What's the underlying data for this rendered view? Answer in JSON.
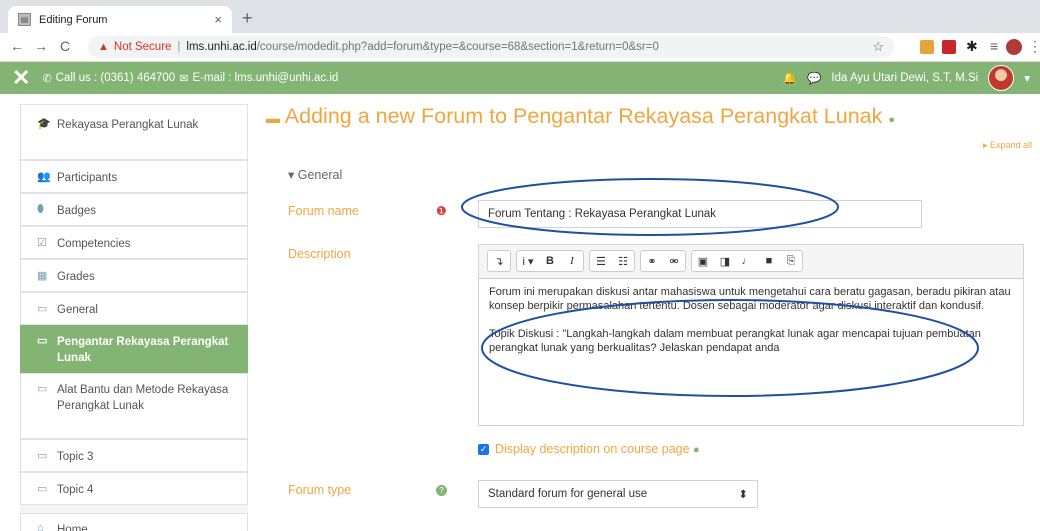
{
  "browser": {
    "tab_title": "Editing Forum",
    "tab_close": "×",
    "new_tab": "+",
    "back": "←",
    "forward": "→",
    "reload": "C",
    "security_label": "Not Secure",
    "url_host": "lms.unhi.ac.id",
    "url_path": "/course/modedit.php?add=forum&type=&course=68&section=1&return=0&sr=0"
  },
  "navbar": {
    "close_symbol": "✕",
    "phone": "Call us : (0361) 464700",
    "email": "E-mail : lms.unhi@unhi.ac.id",
    "user_name": "Ida Ayu Utari Dewi, S.T, M.Si"
  },
  "sidebar": {
    "items": [
      {
        "label": "Rekayasa Perangkat Lunak",
        "icon": "graduation-cap-icon",
        "glyph": "🎓"
      },
      {
        "label": "Participants",
        "icon": "users-icon",
        "glyph": "👥"
      },
      {
        "label": "Badges",
        "icon": "badge-icon",
        "glyph": "⬮"
      },
      {
        "label": "Competencies",
        "icon": "checkbox-icon",
        "glyph": "☑"
      },
      {
        "label": "Grades",
        "icon": "table-icon",
        "glyph": "▦"
      },
      {
        "label": "General",
        "icon": "folder-icon",
        "glyph": "▭"
      },
      {
        "label": "Pengantar Rekayasa Perangkat Lunak",
        "icon": "folder-icon",
        "glyph": "▭"
      },
      {
        "label": "Alat Bantu dan Metode Rekayasa Perangkat Lunak",
        "icon": "folder-icon",
        "glyph": "▭"
      },
      {
        "label": "Topic 3",
        "icon": "folder-icon",
        "glyph": "▭"
      },
      {
        "label": "Topic 4",
        "icon": "folder-icon",
        "glyph": "▭"
      },
      {
        "label": "Home",
        "icon": "home-icon",
        "glyph": "⌂"
      }
    ]
  },
  "main": {
    "title": "Adding a new Forum to Pengantar Rekayasa Perangkat Lunak",
    "expand_all": "Expand all",
    "legend": "General",
    "forum_name_label": "Forum name",
    "forum_name_value": "Forum Tentang : Rekayasa Perangkat Lunak",
    "description_label": "Description",
    "description_p1": "Forum ini merupakan diskusi antar mahasiswa untuk mengetahui cara beratu gagasan, beradu pikiran atau konsep berpikir permasalahan tertentu. Dosen sebagai moderator agar diskusi interaktif dan kondusif.",
    "description_p2": "Topik Diskusi : \"Langkah-langkah dalam membuat perangkat lunak agar mencapai tujuan pembuatan perangkat lunak yang berkualitas? Jelaskan pendapat anda",
    "display_description_label": "Display description on course page",
    "forum_type_label": "Forum type",
    "forum_type_value": "Standard forum for general use"
  },
  "colors": {
    "accent": "#84b473",
    "label": "#f0a640",
    "annotation": "#1f4fa3"
  }
}
